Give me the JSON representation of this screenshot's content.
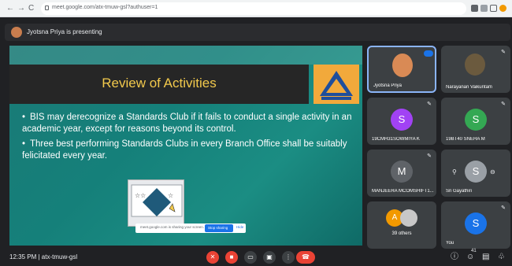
{
  "browser": {
    "back": "←",
    "forward": "→",
    "reload": "C",
    "url": "meet.google.com/atx-tmuw-gsl?authuser=1"
  },
  "header": {
    "presenting_text": "Jyotsna Priya is presenting"
  },
  "slide": {
    "title": "Review of Activities",
    "bullets": [
      "BIS may derecognize a Standards Club if it fails to conduct a single activity in an academic year, except for reasons beyond its control.",
      "Three best performing Standards Clubs in every Branch Office shall be suitably felicitated every year."
    ],
    "share_bar_text": "meet.google.com is sharing your screen.",
    "share_bar_button": "Stop sharing",
    "share_bar_hide": "Hide"
  },
  "participants": [
    {
      "name": "Jyotsna Priya"
    },
    {
      "name": "Narayanan Vaikuntam"
    },
    {
      "name": "19CMH31SOWMIYA K",
      "initial": "S",
      "color": "#a142f4"
    },
    {
      "name": "19BT40 SNEHA M",
      "initial": "S",
      "color": "#34a853"
    },
    {
      "name": "MANJEERA MCOMSHIFT1...",
      "initial": "M",
      "color": "#5f6368"
    },
    {
      "name": "Sri Gayathiri",
      "initial": "S"
    },
    {
      "name": "39 others",
      "initial": "A",
      "color": "#f29900"
    },
    {
      "name": "You",
      "initial": "S",
      "color": "#1a73e8"
    }
  ],
  "footer": {
    "time_code": "12:35 PM  |  atx-tmuw-gsl",
    "people_count": "41"
  },
  "colors": {
    "end_call": "#ea4335",
    "accent": "#1a73e8"
  }
}
